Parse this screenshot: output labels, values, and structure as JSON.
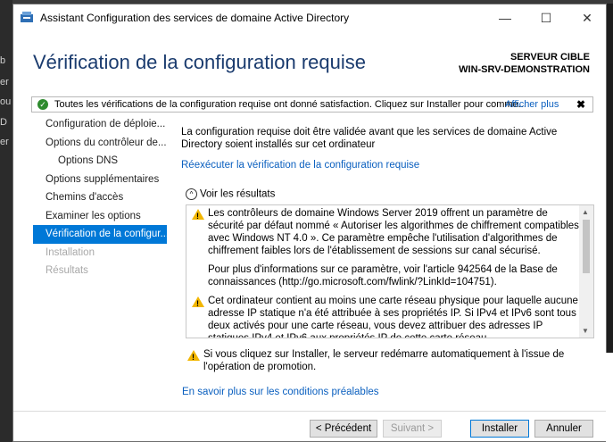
{
  "window": {
    "title": "Assistant Configuration des services de domaine Active Directory",
    "minimize": "—",
    "maximize": "☐",
    "close": "✕"
  },
  "header": {
    "title": "Vérification de la configuration requise",
    "server_label": "SERVEUR CIBLE",
    "server_name": "WIN-SRV-DEMONSTRATION"
  },
  "notice": {
    "text": "Toutes les vérifications de la configuration requise ont donné satisfaction. Cliquez sur Installer pour comme...",
    "more": "Afficher plus",
    "close": "✖",
    "icon_check": "✓"
  },
  "nav": {
    "items": [
      {
        "label": "Configuration de déploie..."
      },
      {
        "label": "Options du contrôleur de..."
      },
      {
        "label": "Options DNS"
      },
      {
        "label": "Options supplémentaires"
      },
      {
        "label": "Chemins d'accès"
      },
      {
        "label": "Examiner les options"
      },
      {
        "label": "Vérification de la configur..."
      },
      {
        "label": "Installation"
      },
      {
        "label": "Résultats"
      }
    ]
  },
  "content": {
    "intro": "La configuration requise doit être validée avant que les services de domaine Active Directory soient installés sur cet ordinateur",
    "rerun": "Réexécuter la vérification de la configuration requise",
    "results_head": "Voir les résultats",
    "results_arrow": "^",
    "results": [
      "Les contrôleurs de domaine Windows Server 2019 offrent un paramètre de sécurité par défaut nommé « Autoriser les algorithmes de chiffrement compatibles avec Windows NT 4.0 ». Ce paramètre empêche l'utilisation d'algorithmes de chiffrement faibles lors de l'établissement de sessions sur canal sécurisé.",
      "Pour plus d'informations sur ce paramètre, voir l'article 942564 de la Base de connaissances (http://go.microsoft.com/fwlink/?LinkId=104751).",
      "Cet ordinateur contient au moins une carte réseau physique pour laquelle aucune adresse IP statique n'a été attribuée à ses propriétés IP. Si IPv4 et IPv6 sont tous deux activés pour une carte réseau, vous devez attribuer des adresses IP statiques IPv4 et IPv6 aux propriétés IP de cette carte réseau..."
    ],
    "restart": "Si vous cliquez sur Installer, le serveur redémarre automatiquement à l'issue de l'opération de promotion.",
    "learn_more": "En savoir plus sur les conditions préalables"
  },
  "footer": {
    "previous": "< Précédent",
    "next": "Suivant >",
    "install": "Installer",
    "cancel": "Annuler"
  },
  "background": {
    "left_chars": [
      "b",
      "er",
      "ou",
      "D",
      "er"
    ]
  },
  "colors": {
    "title_blue": "#1a3b6e",
    "selection": "#0078d7",
    "link": "#0a5fbf",
    "warning": "#f2b600",
    "success": "#2e8b2e"
  }
}
